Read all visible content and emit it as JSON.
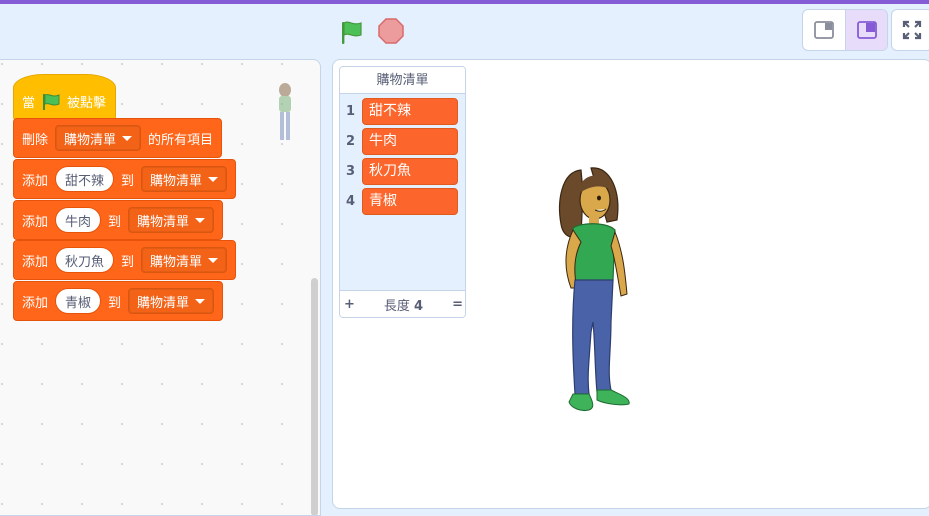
{
  "header": {
    "green_flag_icon": "green-flag",
    "stop_icon": "stop-sign",
    "layout_modes": [
      "small-stage",
      "normal-stage"
    ],
    "active_layout_mode": "normal-stage",
    "fullscreen_icon": "fullscreen"
  },
  "colors": {
    "accent": "#855cd6",
    "events": "#ffbf00",
    "list_blocks": "#ff661a",
    "list_item": "#fc662c"
  },
  "script": {
    "hat": {
      "prefix": "當",
      "icon": "green-flag",
      "suffix": "被點擊"
    },
    "blocks": [
      {
        "verb": "刪除",
        "list": "購物清單",
        "tail": "的所有項目"
      },
      {
        "verb": "添加",
        "value": "甜不辣",
        "to": "到",
        "list": "購物清單"
      },
      {
        "verb": "添加",
        "value": "牛肉",
        "to": "到",
        "list": "購物清單"
      },
      {
        "verb": "添加",
        "value": "秋刀魚",
        "to": "到",
        "list": "購物清單"
      },
      {
        "verb": "添加",
        "value": "青椒",
        "to": "到",
        "list": "購物清單"
      }
    ]
  },
  "stage": {
    "list_monitor": {
      "title": "購物清單",
      "items": [
        {
          "index": "1",
          "value": "甜不辣"
        },
        {
          "index": "2",
          "value": "牛肉"
        },
        {
          "index": "3",
          "value": "秋刀魚"
        },
        {
          "index": "4",
          "value": "青椒"
        }
      ],
      "add_symbol": "+",
      "length_label": "長度",
      "length_value": "4",
      "resize_symbol": "="
    }
  }
}
